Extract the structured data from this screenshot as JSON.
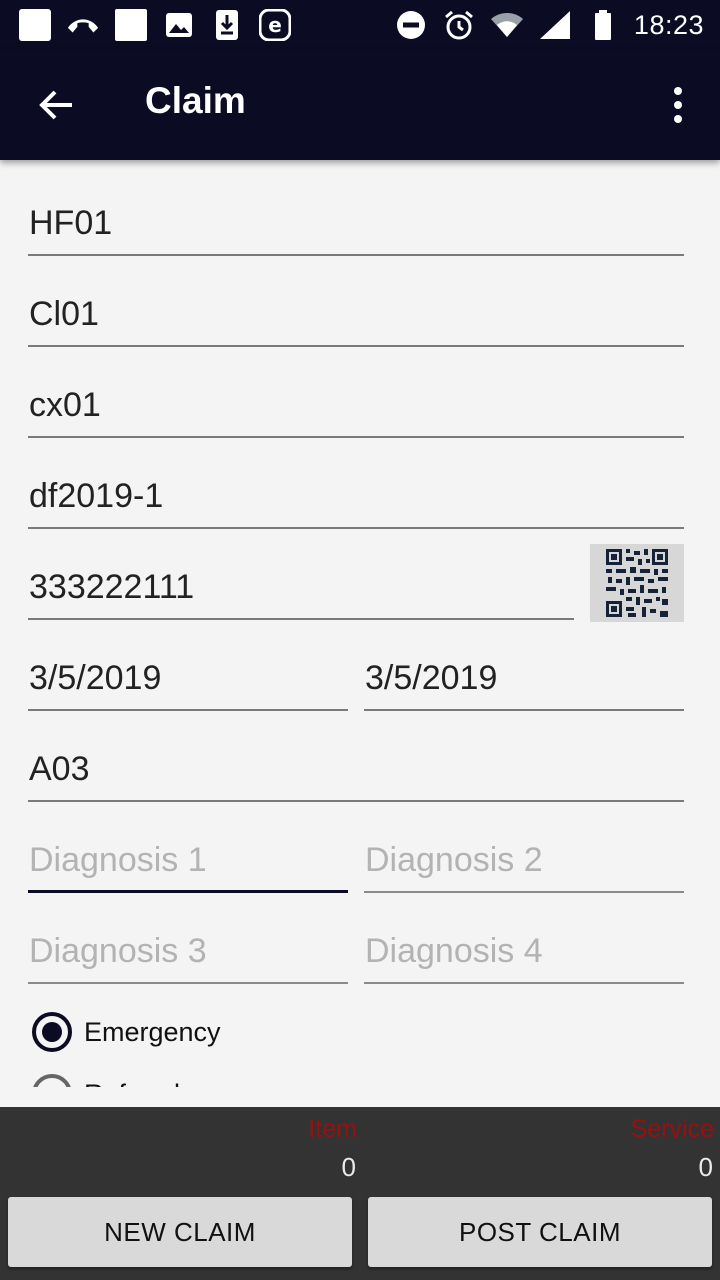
{
  "status_bar": {
    "time": "18:23",
    "left_icons": [
      "notification-square-icon",
      "missed-call-icon",
      "notification-square-icon",
      "image-icon",
      "download-icon",
      "e-app-icon"
    ],
    "right_icons": [
      "do-not-disturb-icon",
      "alarm-icon",
      "wifi-icon",
      "signal-icon",
      "battery-icon"
    ]
  },
  "app_bar": {
    "title": "Claim",
    "background": "#0b0c23"
  },
  "form": {
    "health_facility": "HF01",
    "claim_admin": "Cl01",
    "claim_code": "cx01",
    "guarantee_no": "df2019-1",
    "insurance_no": "333222111",
    "start_date": "3/5/2019",
    "end_date": "3/5/2019",
    "main_diagnosis": "A03",
    "diagnosis1_placeholder": "Diagnosis 1",
    "diagnosis2_placeholder": "Diagnosis 2",
    "diagnosis3_placeholder": "Diagnosis 3",
    "diagnosis4_placeholder": "Diagnosis 4",
    "visit_types": [
      {
        "label": "Emergency",
        "selected": true
      },
      {
        "label": "Referral",
        "selected": false
      }
    ]
  },
  "bottom": {
    "item_label": "Item",
    "item_count": "0",
    "service_label": "Service",
    "service_count": "0",
    "new_claim_label": "NEW CLAIM",
    "post_claim_label": "POST CLAIM",
    "accent_label_color": "#9a1010"
  }
}
